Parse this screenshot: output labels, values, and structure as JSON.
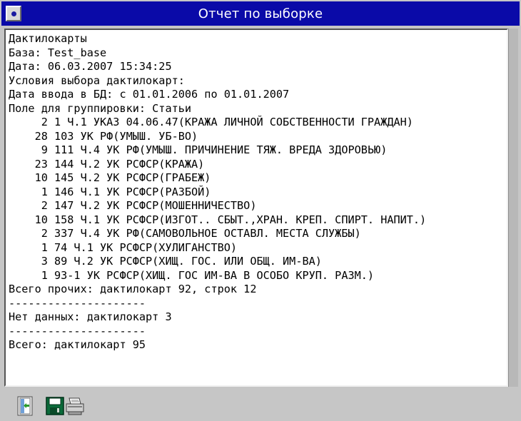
{
  "window": {
    "title": "Отчет по выборке"
  },
  "report": {
    "lines": [
      "Дактилокарты",
      "База: Test_base",
      "Дата: 06.03.2007 15:34:25",
      "Условия выбора дактилокарт:",
      "Дата ввода в БД: с 01.01.2006 по 01.01.2007",
      "Поле для группировки: Статьи",
      "     2 1 Ч.1 УКАЗ 04.06.47(КРАЖА ЛИЧНОЙ СОБСТВЕННОСТИ ГРАЖДАН)",
      "    28 103 УК РФ(УМЫШ. УБ-ВО)",
      "     9 111 Ч.4 УК РФ(УМЫШ. ПРИЧИНЕНИЕ ТЯЖ. ВРЕДА ЗДОРОВЬЮ)",
      "    23 144 Ч.2 УК РСФСР(КРАЖА)",
      "    10 145 Ч.2 УК РСФСР(ГРАБЕЖ)",
      "     1 146 Ч.1 УК РСФСР(РАЗБОЙ)",
      "     2 147 Ч.2 УК РСФСР(МОШЕННИЧЕСТВО)",
      "    10 158 Ч.1 УК РСФСР(ИЗГОТ.. СБЫТ.,ХРАН. КРЕП. СПИРТ. НАПИТ.)",
      "     2 337 Ч.4 УК РФ(САМОВОЛЬНОЕ ОСТАВЛ. МЕСТА СЛУЖБЫ)",
      "     1 74 Ч.1 УК РСФСР(ХУЛИГАНСТВО)",
      "     3 89 Ч.2 УК РСФСР(ХИЩ. ГОС. ИЛИ ОБЩ. ИМ-ВА)",
      "     1 93-1 УК РСФСР(ХИЩ. ГОС ИМ-ВА В ОСОБО КРУП. РАЗМ.)",
      "Всего прочих: дактилокарт 92, строк 12",
      "---------------------",
      "Нет данных: дактилокарт 3",
      "---------------------",
      "Всего: дактилокарт 95"
    ]
  },
  "toolbar": {
    "buttons": [
      {
        "icon": "exit-door-icon"
      },
      {
        "icon": "save-floppy-icon"
      },
      {
        "icon": "printer-icon"
      }
    ]
  },
  "colors": {
    "titlebar": "#0a0aa8",
    "background": "#c6c6c6",
    "report_bg": "#ffffff"
  }
}
